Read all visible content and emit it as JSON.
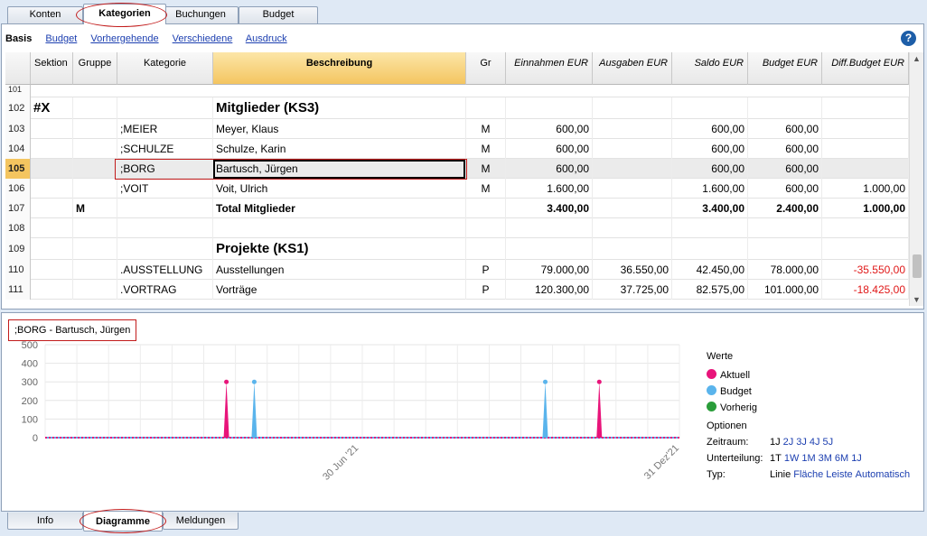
{
  "top_tabs": [
    {
      "label": "Konten"
    },
    {
      "label": "Kategorien",
      "active": true
    },
    {
      "label": "Buchungen"
    },
    {
      "label": "Budget"
    }
  ],
  "view_bar": {
    "current": "Basis",
    "links": [
      "Budget",
      "Vorhergehende",
      "Verschiedene",
      "Ausdruck"
    ]
  },
  "help_icon": {
    "icon": "help-icon",
    "glyph": "?"
  },
  "columns": [
    "",
    "Sektion",
    "Gruppe",
    "Kategorie",
    "Beschreibung",
    "Gr",
    "Einnahmen EUR",
    "Ausgaben EUR",
    "Saldo EUR",
    "Budget EUR",
    "Diff.Budget EUR"
  ],
  "partial_row_number": "101",
  "rows": [
    {
      "rn": "102",
      "sektion": "#X",
      "gruppe": "",
      "kategorie": "",
      "beschreibung": "Mitglieder (KS3)",
      "gr": "",
      "einnahmen": "",
      "ausgaben": "",
      "saldo": "",
      "budget": "",
      "diff": "",
      "style": "big"
    },
    {
      "rn": "103",
      "sektion": "",
      "gruppe": "",
      "kategorie": ";MEIER",
      "beschreibung": "Meyer, Klaus",
      "gr": "M",
      "einnahmen": "600,00",
      "ausgaben": "",
      "saldo": "600,00",
      "budget": "600,00",
      "diff": "",
      "style": ""
    },
    {
      "rn": "104",
      "sektion": "",
      "gruppe": "",
      "kategorie": ";SCHULZE",
      "beschreibung": "Schulze, Karin",
      "gr": "M",
      "einnahmen": "600,00",
      "ausgaben": "",
      "saldo": "600,00",
      "budget": "600,00",
      "diff": "",
      "style": ""
    },
    {
      "rn": "105",
      "sektion": "",
      "gruppe": "",
      "kategorie": ";BORG",
      "beschreibung": "Bartusch, Jürgen",
      "gr": "M",
      "einnahmen": "600,00",
      "ausgaben": "",
      "saldo": "600,00",
      "budget": "600,00",
      "diff": "",
      "style": "current"
    },
    {
      "rn": "106",
      "sektion": "",
      "gruppe": "",
      "kategorie": ";VOIT",
      "beschreibung": "Voit, Ulrich",
      "gr": "M",
      "einnahmen": "1.600,00",
      "ausgaben": "",
      "saldo": "1.600,00",
      "budget": "600,00",
      "diff": "1.000,00",
      "style": ""
    },
    {
      "rn": "107",
      "sektion": "",
      "gruppe": "M",
      "kategorie": "",
      "beschreibung": "Total Mitglieder",
      "gr": "",
      "einnahmen": "3.400,00",
      "ausgaben": "",
      "saldo": "3.400,00",
      "budget": "2.400,00",
      "diff": "1.000,00",
      "style": "bold"
    },
    {
      "rn": "108",
      "sektion": "",
      "gruppe": "",
      "kategorie": "",
      "beschreibung": "",
      "gr": "",
      "einnahmen": "",
      "ausgaben": "",
      "saldo": "",
      "budget": "",
      "diff": "",
      "style": ""
    },
    {
      "rn": "109",
      "sektion": "",
      "gruppe": "",
      "kategorie": "",
      "beschreibung": "Projekte (KS1)",
      "gr": "",
      "einnahmen": "",
      "ausgaben": "",
      "saldo": "",
      "budget": "",
      "diff": "",
      "style": "big"
    },
    {
      "rn": "110",
      "sektion": "",
      "gruppe": "",
      "kategorie": ".AUSSTELLUNG",
      "beschreibung": "Ausstellungen",
      "gr": "P",
      "einnahmen": "79.000,00",
      "ausgaben": "36.550,00",
      "saldo": "42.450,00",
      "budget": "78.000,00",
      "diff": "-35.550,00",
      "style": ""
    },
    {
      "rn": "111",
      "sektion": "",
      "gruppe": "",
      "kategorie": ".VORTRAG",
      "beschreibung": "Vorträge",
      "gr": "P",
      "einnahmen": "120.300,00",
      "ausgaben": "37.725,00",
      "saldo": "82.575,00",
      "budget": "101.000,00",
      "diff": "-18.425,00",
      "style": ""
    }
  ],
  "chart": {
    "title": ";BORG - Bartusch, Jürgen",
    "y_ticks": [
      "500",
      "400",
      "300",
      "200",
      "100",
      "0"
    ],
    "x_ticks": [
      "30 Jun '21",
      "31 Dez'21"
    ]
  },
  "chart_data": {
    "type": "line",
    "title": ";BORG - Bartusch, Jürgen",
    "xlabel": "",
    "ylabel": "",
    "ylim": [
      0,
      500
    ],
    "x_range": [
      "2021-01-01",
      "2021-12-31"
    ],
    "x_ticks": [
      "30 Jun '21",
      "31 Dez'21"
    ],
    "series": [
      {
        "name": "Aktuell",
        "color": "#e8147a",
        "points": [
          {
            "x": "2021-04-15",
            "y": 300
          },
          {
            "x": "2021-11-15",
            "y": 300
          }
        ]
      },
      {
        "name": "Budget",
        "color": "#5ab4ec",
        "points": [
          {
            "x": "2021-05-01",
            "y": 300
          },
          {
            "x": "2021-10-15",
            "y": 300
          }
        ]
      },
      {
        "name": "Vorherig",
        "color": "#2a9d3a",
        "points": []
      }
    ],
    "baseline": 0,
    "grid": true,
    "legend_position": "right"
  },
  "legend": {
    "title": "Werte",
    "items": [
      {
        "label": "Aktuell",
        "color": "#e8147a"
      },
      {
        "label": "Budget",
        "color": "#5ab4ec"
      },
      {
        "label": "Vorherig",
        "color": "#2a9d3a"
      }
    ]
  },
  "options": {
    "title": "Optionen",
    "zeitraum": {
      "label": "Zeitraum:",
      "items": [
        "1J",
        "2J",
        "3J",
        "4J",
        "5J"
      ],
      "selected": "1J"
    },
    "unterteilung": {
      "label": "Unterteilung:",
      "items": [
        "1T",
        "1W",
        "1M",
        "3M",
        "6M",
        "1J"
      ],
      "selected": "1T"
    },
    "typ": {
      "label": "Typ:",
      "items": [
        "Linie",
        "Fläche",
        "Leiste",
        "Automatisch"
      ],
      "selected": "Linie"
    }
  },
  "bottom_tabs": [
    {
      "label": "Info"
    },
    {
      "label": "Diagramme",
      "active": true
    },
    {
      "label": "Meldungen"
    }
  ]
}
